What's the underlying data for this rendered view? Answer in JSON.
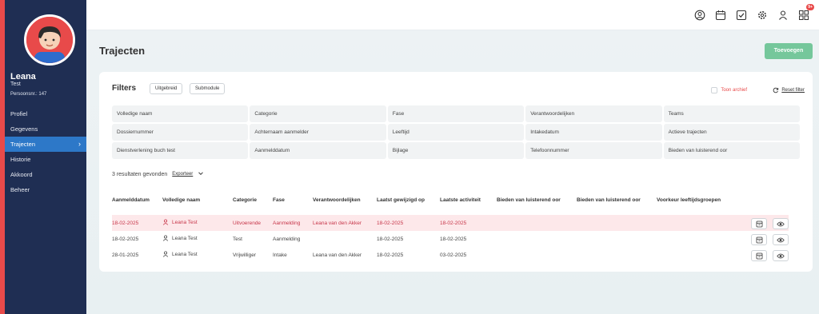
{
  "sidebar": {
    "user_name": "Leana",
    "user_role": "Test",
    "user_number": "Persoonsnr.: 147",
    "items": [
      {
        "label": "Profiel"
      },
      {
        "label": "Gegevens"
      },
      {
        "label": "Trajecten"
      },
      {
        "label": "Historie"
      },
      {
        "label": "Akkoord"
      },
      {
        "label": "Beheer"
      }
    ]
  },
  "topbar": {
    "icons": [
      "user-circle-icon",
      "calendar-icon",
      "check-square-icon",
      "gear-icon",
      "person-icon",
      "apps-grid-icon"
    ],
    "badge": "9+"
  },
  "page": {
    "title": "Trajecten",
    "add_button": "Toevoegen"
  },
  "filters": {
    "title": "Filters",
    "btn_extended": "Uitgebreid",
    "btn_submodule": "Submodule",
    "archive_label": "Toon archief",
    "reset_label": "Reset filter",
    "fields": [
      "Volledige naam",
      "Categorie",
      "Fase",
      "Verantwoordelijken",
      "Teams",
      "Dossiernummer",
      "Achternaam aanmelder",
      "Leeftijd",
      "Intakedatum",
      "Actieve trajecten",
      "Dienstverlening buch test",
      "Aanmelddatum",
      "Bijlage",
      "Telefoonnummer",
      "Bieden van luisterend oor"
    ]
  },
  "results": {
    "text": "3 resultaten gevonden",
    "export": "Exporteer"
  },
  "table": {
    "headers": [
      "Aanmelddatum",
      "Volledige naam",
      "Categorie",
      "Fase",
      "Verantwoordelijken",
      "Laatst gewijzigd op",
      "Laatste activiteit",
      "Bieden van luisterend oor",
      "Bieden van luisterend oor",
      "Voorkeur leeftijdsgroepen"
    ],
    "rows": [
      {
        "date": "18-02-2025",
        "name": "Leana Test",
        "category": "Uitvoerende",
        "phase": "Aanmelding",
        "resp": "Leana van den Akker",
        "modified": "18-02-2025",
        "activity": "18-02-2025"
      },
      {
        "date": "18-02-2025",
        "name": "Leana Test",
        "category": "Test",
        "phase": "Aanmelding",
        "resp": "",
        "modified": "18-02-2025",
        "activity": "18-02-2025"
      },
      {
        "date": "28-01-2025",
        "name": "Leana Test",
        "category": "Vrijwilliger",
        "phase": "Intake",
        "resp": "Leana van den Akker",
        "modified": "18-02-2025",
        "activity": "03-02-2025"
      }
    ]
  },
  "colors": {
    "sidebar": "#1f2e53",
    "accent_red": "#e84a4a",
    "active_nav": "#2d78c8",
    "add_button": "#75c79b",
    "highlight_row": "#fde8ea"
  }
}
